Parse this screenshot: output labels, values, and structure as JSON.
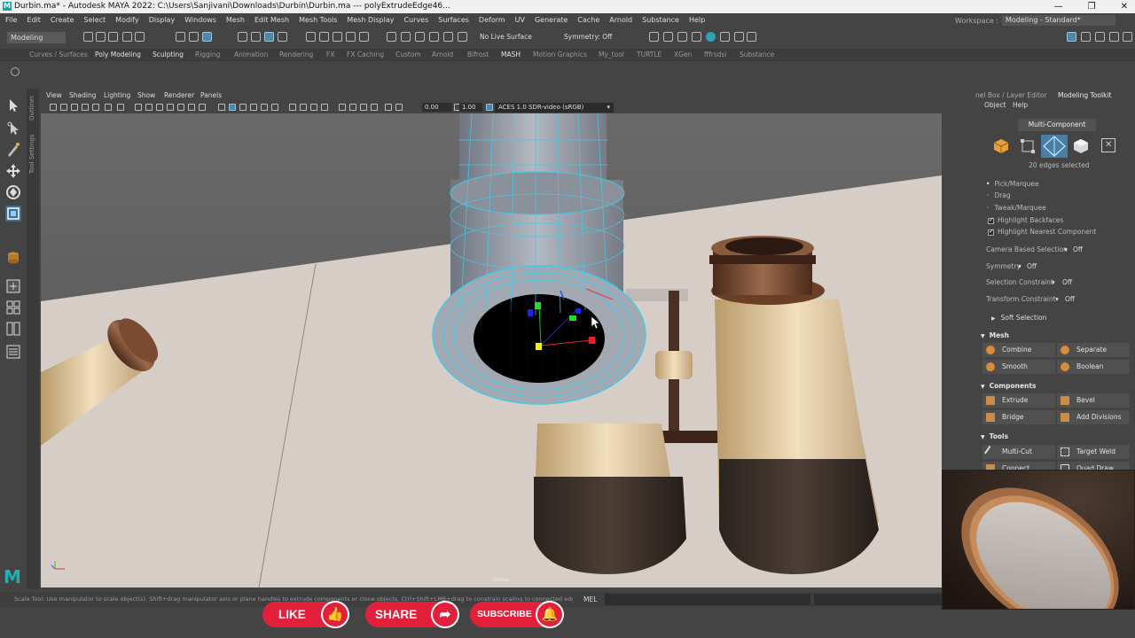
{
  "window": {
    "title": "Durbin.ma* - Autodesk MAYA 2022: C:\\Users\\Sanjivani\\Downloads\\Durbin\\Durbin.ma   ---   polyExtrudeEdge46...",
    "controls": [
      "—",
      "❐",
      "✕"
    ]
  },
  "menu": [
    "File",
    "Edit",
    "Create",
    "Select",
    "Modify",
    "Display",
    "Windows",
    "Mesh",
    "Edit Mesh",
    "Mesh Tools",
    "Mesh Display",
    "Curves",
    "Surfaces",
    "Deform",
    "UV",
    "Generate",
    "Cache",
    "Arnold",
    "Substance",
    "Help"
  ],
  "workspace": {
    "label": "Workspace :",
    "value": "Modeling - Standard*"
  },
  "status_line": {
    "mode": "Modeling",
    "live_surface": "No Live Surface",
    "symmetry": "Symmetry: Off"
  },
  "shelf_tabs": [
    "Curves / Surfaces",
    "Poly Modeling",
    "Sculpting",
    "Rigging",
    "Animation",
    "Rendering",
    "FX",
    "FX Caching",
    "Custom",
    "Arnold",
    "Bifrost",
    "MASH",
    "Motion Graphics",
    "My_tool",
    "TURTLE",
    "XGen",
    "fffrsdsi",
    "Substance"
  ],
  "side_tabs": [
    "Outliner",
    "Tool Settings"
  ],
  "panel_menu": [
    "View",
    "Shading",
    "Lighting",
    "Show",
    "Renderer",
    "Panels"
  ],
  "panel_toolbar": {
    "exposure": "0.00",
    "gamma": "1.00",
    "color_space": "ACES 1.0 SDR-video (sRGB)"
  },
  "viewport": {
    "camera_label": "persp"
  },
  "right_panel": {
    "tabs": [
      "nel Box / Layer Editor",
      "Modeling Toolkit"
    ],
    "menu": [
      "Object",
      "Help"
    ],
    "mode_header": "Multi-Component",
    "selection_info": "20 edges selected",
    "pick_options": [
      "Pick/Marquee",
      "Drag",
      "Tweak/Marquee"
    ],
    "checkboxes": [
      {
        "label": "Highlight Backfaces",
        "checked": true
      },
      {
        "label": "Highlight Nearest Component",
        "checked": true
      }
    ],
    "settings": [
      {
        "label": "Camera Based Selection",
        "value": "Off"
      },
      {
        "label": "Symmetry",
        "value": "Off"
      },
      {
        "label": "Selection Constraint",
        "value": "Off"
      },
      {
        "label": "Transform Constraint",
        "value": "Off"
      }
    ],
    "soft_selection": "Soft Selection",
    "sections": {
      "mesh": {
        "title": "Mesh",
        "buttons": [
          "Combine",
          "Separate",
          "Smooth",
          "Boolean"
        ]
      },
      "components": {
        "title": "Components",
        "buttons": [
          "Extrude",
          "Bevel",
          "Bridge",
          "Add Divisions"
        ]
      },
      "tools": {
        "title": "Tools",
        "buttons": [
          "Multi-Cut",
          "Target Weld",
          "Connect",
          "Quad Draw"
        ]
      }
    }
  },
  "help_line": {
    "text": "Scale Tool: Use manipulator to scale object(s). Shift+drag manipulator axis or plane handles to extrude components or clone objects. Ctrl+Shift+LMB+drag to constrain scaling to connected edges. Use D or INSERT",
    "mel_label": "MEL"
  },
  "social": {
    "like": "LIKE",
    "share": "SHARE",
    "subscribe": "SUBSCRIBE"
  },
  "colors": {
    "accent": "#5285a6",
    "wire": "#46c8e6",
    "social_red": "#e3203a",
    "maya_teal": "#1fb0b3"
  }
}
